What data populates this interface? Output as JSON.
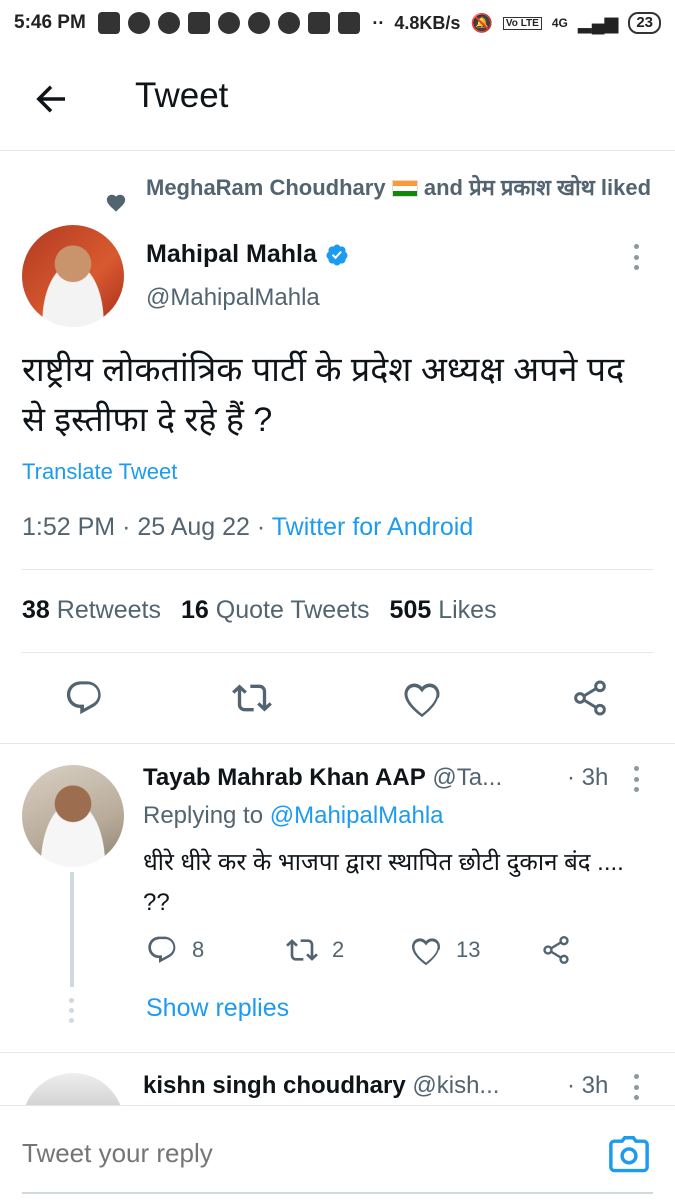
{
  "status_bar": {
    "time": "5:46 PM",
    "network_speed": "4.8KB/s",
    "network_type": "4G",
    "volte": "Vo LTE",
    "battery": "23"
  },
  "header": {
    "title": "Tweet",
    "back_icon": "arrow-left-icon"
  },
  "social_context": {
    "icon": "heart-icon",
    "text_part1": "MeghaRam Choudhary",
    "text_part2": "and प्रेम प्रकाश खोथ liked"
  },
  "tweet": {
    "author_name": "Mahipal Mahla",
    "author_handle": "@MahipalMahla",
    "text": "राष्ट्रीय लोकतांत्रिक पार्टी के प्रदेश अध्यक्ष अपने पद से इस्तीफा दे रहे हैं ?",
    "translate_label": "Translate Tweet",
    "time": "1:52 PM",
    "date": "25 Aug 22",
    "source": "Twitter for Android",
    "stats": {
      "retweets_count": "38",
      "retweets_label": "Retweets",
      "quotes_count": "16",
      "quotes_label": "Quote Tweets",
      "likes_count": "505",
      "likes_label": "Likes"
    }
  },
  "replies": [
    {
      "name": "Tayab Mahrab Khan AAP",
      "handle": "@Ta...",
      "time": "· 3h",
      "replying_prefix": "Replying to",
      "replying_handle": "@MahipalMahla",
      "text": "धीरे धीरे कर के भाजपा द्वारा स्थापित छोटी दुकान बंद .... ??",
      "reply_count": "8",
      "retweet_count": "2",
      "like_count": "13",
      "show_replies_label": "Show replies"
    },
    {
      "name": "kishn singh choudhary",
      "handle": "@kish...",
      "time": "· 3h"
    }
  ],
  "compose": {
    "placeholder": "Tweet your reply",
    "camera_icon": "camera-icon"
  },
  "colors": {
    "accent": "#1d9bf0",
    "text_primary": "#0f1419",
    "text_secondary": "#536471"
  }
}
